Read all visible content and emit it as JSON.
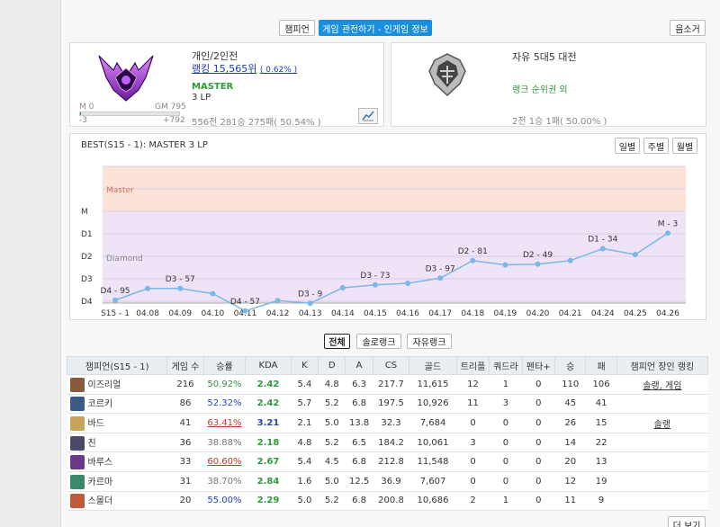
{
  "top_tabs": [
    "챔피언",
    "게임 관전하기 - 인게임 정보"
  ],
  "summoner_button": "음소거",
  "solo": {
    "queue": "개인/2인전",
    "ranking_prefix": "랭킹 15,565위",
    "ranking_pct": "( 0.62% )",
    "tier": "MASTER",
    "lp": "3 LP",
    "bar_left": "M 0",
    "bar_right": "GM 795",
    "bar_min": "-3",
    "bar_max": "+792",
    "bar_progress": 0.004,
    "record": "556전 281승 275패( 50.54% )"
  },
  "flex": {
    "queue": "자유 5대5 대전",
    "status": "랭크 순위권 외",
    "record": "2전 1승 1패( 50.00% )"
  },
  "chart_card": {
    "title": "BEST(S15 - 1): MASTER 3 LP",
    "buttons": [
      "일별",
      "주별",
      "월별"
    ]
  },
  "chart_data": {
    "type": "line",
    "x": [
      "S15 - 1",
      "04.08",
      "04.09",
      "04.10",
      "04.11",
      "04.12",
      "04.13",
      "04.14",
      "04.15",
      "04.16",
      "04.17",
      "04.18",
      "04.19",
      "04.20",
      "04.21",
      "04.24",
      "04.25",
      "04.26"
    ],
    "y": [
      -95,
      -43,
      -43,
      -66,
      -143,
      -97,
      -109,
      -40,
      -27,
      -20,
      3,
      81,
      62,
      65,
      81,
      134,
      108,
      203
    ],
    "y_ticks": [
      "M",
      "D1",
      "D2",
      "D3",
      "D4"
    ],
    "bands": [
      "Master",
      "Diamond"
    ],
    "point_labels": [
      {
        "i": 0,
        "text": "D4 - 95"
      },
      {
        "i": 2,
        "text": "D3 - 57"
      },
      {
        "i": 4,
        "text": "D4 - 57"
      },
      {
        "i": 6,
        "text": "D3 - 9"
      },
      {
        "i": 8,
        "text": "D3 - 73"
      },
      {
        "i": 10,
        "text": "D3 - 97"
      },
      {
        "i": 11,
        "text": "D2 - 81"
      },
      {
        "i": 13,
        "text": "D2 - 49"
      },
      {
        "i": 15,
        "text": "D1 - 34"
      },
      {
        "i": 17,
        "text": "M - 3"
      }
    ],
    "line_color": "#7ab8e8"
  },
  "filter_tabs": [
    "전체",
    "솔로랭크",
    "자유랭크"
  ],
  "table": {
    "headers": [
      "챔피언(S15 - 1)",
      "게임 수",
      "승률",
      "KDA",
      "K",
      "D",
      "A",
      "CS",
      "골드",
      "트리플",
      "쿼드라",
      "펜타+",
      "승",
      "패",
      "챔피언 장인 랭킹"
    ],
    "rows": [
      {
        "name": "이즈리얼",
        "games": "216",
        "wr": "50.92%",
        "wrc": "wr-green",
        "kda": "2.42",
        "kc": "kda",
        "k": "5.4",
        "d": "4.8",
        "a": "6.3",
        "cs": "217.7",
        "gold": "11,615",
        "tri": "12",
        "quad": "1",
        "penta": "0",
        "w": "110",
        "l": "106",
        "rank": "솔랭, 게임",
        "icon": "#8a5a3c"
      },
      {
        "name": "코르키",
        "games": "86",
        "wr": "52.32%",
        "wrc": "wr-blue",
        "kda": "2.42",
        "kc": "kda",
        "k": "5.7",
        "d": "5.2",
        "a": "6.8",
        "cs": "197.5",
        "gold": "10,926",
        "tri": "11",
        "quad": "3",
        "penta": "0",
        "w": "45",
        "l": "41",
        "rank": "",
        "icon": "#3a5a8a"
      },
      {
        "name": "바드",
        "games": "41",
        "wr": "63.41%",
        "wrc": "wr-red",
        "kda": "3.21",
        "kc": "kda-blue",
        "k": "2.1",
        "d": "5.0",
        "a": "13.8",
        "cs": "32.3",
        "gold": "7,684",
        "tri": "0",
        "quad": "0",
        "penta": "0",
        "w": "26",
        "l": "15",
        "rank": "솔랭",
        "icon": "#c9a35a"
      },
      {
        "name": "친",
        "games": "36",
        "wr": "38.88%",
        "wrc": "wr-gray",
        "kda": "2.18",
        "kc": "kda",
        "k": "4.8",
        "d": "5.2",
        "a": "6.5",
        "cs": "184.2",
        "gold": "10,061",
        "tri": "3",
        "quad": "0",
        "penta": "0",
        "w": "14",
        "l": "22",
        "rank": "",
        "icon": "#4a4a6a"
      },
      {
        "name": "바루스",
        "games": "33",
        "wr": "60.60%",
        "wrc": "wr-red",
        "kda": "2.67",
        "kc": "kda",
        "k": "5.4",
        "d": "4.5",
        "a": "6.8",
        "cs": "212.8",
        "gold": "11,548",
        "tri": "0",
        "quad": "0",
        "penta": "0",
        "w": "20",
        "l": "13",
        "rank": "",
        "icon": "#6a3a8a"
      },
      {
        "name": "카르마",
        "games": "31",
        "wr": "38.70%",
        "wrc": "wr-gray",
        "kda": "2.84",
        "kc": "kda",
        "k": "1.6",
        "d": "5.0",
        "a": "12.5",
        "cs": "36.9",
        "gold": "7,607",
        "tri": "0",
        "quad": "0",
        "penta": "0",
        "w": "12",
        "l": "19",
        "rank": "",
        "icon": "#3a8a6a"
      },
      {
        "name": "스몰더",
        "games": "20",
        "wr": "55.00%",
        "wrc": "wr-blue",
        "kda": "2.29",
        "kc": "kda",
        "k": "5.0",
        "d": "5.2",
        "a": "6.8",
        "cs": "200.8",
        "gold": "10,686",
        "tri": "2",
        "quad": "1",
        "penta": "0",
        "w": "11",
        "l": "9",
        "rank": "",
        "icon": "#c05a3a"
      }
    ]
  },
  "more_button": "더 보기"
}
